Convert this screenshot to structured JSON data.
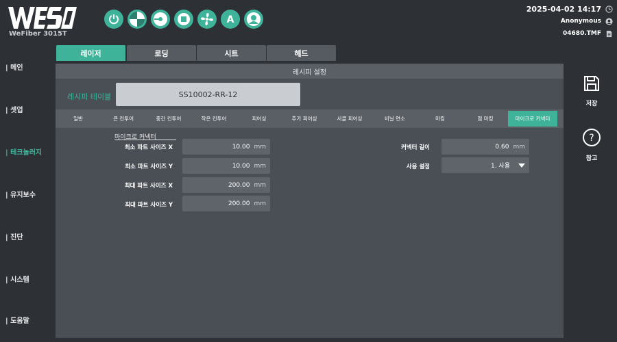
{
  "header": {
    "logo_text": "WESO",
    "model": "WeFiber 3015T",
    "toolbar_icons": [
      "power-icon",
      "pie-icon",
      "plug-icon",
      "stop-icon",
      "fan-icon",
      "a-icon",
      "user-icon"
    ],
    "datetime": "2025-04-02 14:17",
    "user": "Anonymous",
    "file": "04680.TMF",
    "accent_color": "#3fb39a"
  },
  "nav": {
    "items": [
      {
        "label": "| 메인"
      },
      {
        "label": "| 셋업"
      },
      {
        "label": "| 테크놀러지"
      },
      {
        "label": "| 유지보수"
      },
      {
        "label": "| 진단"
      },
      {
        "label": "| 시스템"
      },
      {
        "label": "| 도움말"
      }
    ],
    "active_index": 2
  },
  "tabs": [
    {
      "label": "레이저"
    },
    {
      "label": "로딩"
    },
    {
      "label": "시트"
    },
    {
      "label": "헤드"
    }
  ],
  "panel": {
    "title": "레시피 설정",
    "recipe_label": "레시피 테이블",
    "recipe_value": "SS10002-RR-12",
    "subtabs": [
      {
        "label": "일반"
      },
      {
        "label": "큰 컨투어"
      },
      {
        "label": "중간 컨투어"
      },
      {
        "label": "작은 컨투어"
      },
      {
        "label": "피어싱"
      },
      {
        "label": "추가 피어싱"
      },
      {
        "label": "서클 피어싱"
      },
      {
        "label": "비닐 연소"
      },
      {
        "label": "마킹"
      },
      {
        "label": "점 마킹"
      },
      {
        "label": "마이크로 커넥터"
      }
    ],
    "active_subtab_index": 10,
    "section_title": "마이크로 커넥터",
    "left_fields": [
      {
        "label": "최소 파트 사이즈 X",
        "value": "10.00",
        "unit": "mm"
      },
      {
        "label": "최소 파트 사이즈 Y",
        "value": "10.00",
        "unit": "mm"
      },
      {
        "label": "최대 파트 사이즈 X",
        "value": "200.00",
        "unit": "mm"
      },
      {
        "label": "최대 파트 사이즈 Y",
        "value": "200.00",
        "unit": "mm"
      }
    ],
    "right_fields": {
      "length": {
        "label": "커넥터 길이",
        "value": "0.60",
        "unit": "mm"
      },
      "usage": {
        "label": "사용 설정",
        "value": "1. 사용"
      }
    }
  },
  "actions": {
    "save_label": "저장",
    "help_label": "참고"
  }
}
